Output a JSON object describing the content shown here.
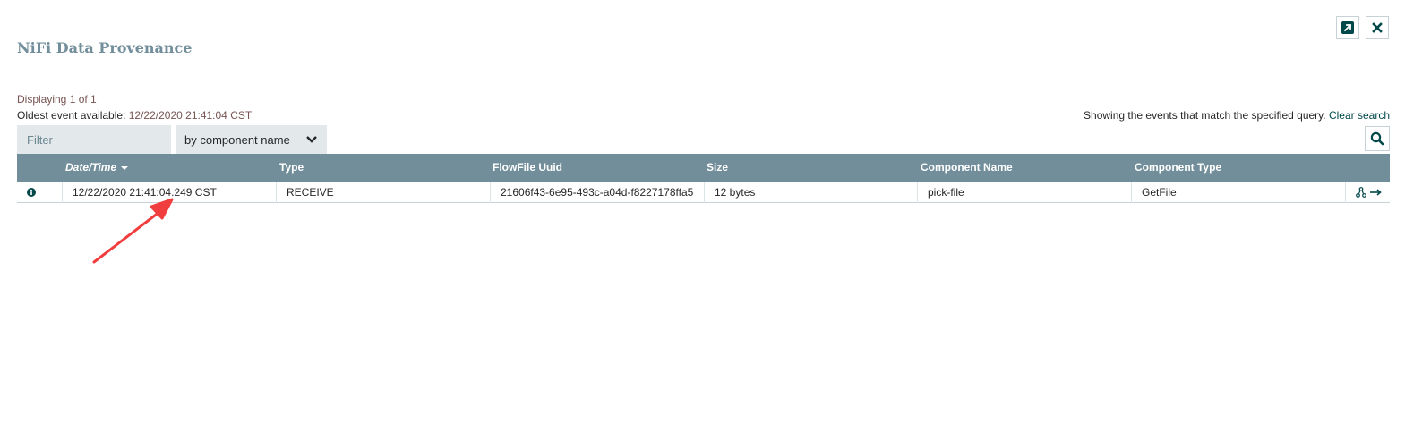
{
  "window": {
    "title": "NiFi Data Provenance",
    "icons": [
      "popout-icon",
      "close-icon"
    ]
  },
  "status": {
    "displaying": "Displaying 1 of 1",
    "oldest_label": "Oldest event available: ",
    "oldest_value": "12/22/2020 21:41:04 CST",
    "showing_text": "Showing the events that match the specified query.",
    "clear_search": "Clear search"
  },
  "filter": {
    "placeholder": "Filter",
    "value": "",
    "by_option": "by component name"
  },
  "table": {
    "columns": [
      "",
      "Date/Time",
      "Type",
      "FlowFile Uuid",
      "Size",
      "Component Name",
      "Component Type",
      ""
    ],
    "sorted_column": "Date/Time",
    "rows": [
      {
        "datetime": "12/22/2020 21:41:04.249 CST",
        "type": "RECEIVE",
        "uuid": "21606f43-6e95-493c-a04d-f8227178ffa5",
        "size": "12 bytes",
        "component_name": "pick-file",
        "component_type": "GetFile"
      }
    ]
  },
  "colors": {
    "header_bg": "#728e9b",
    "title": "#728e9b",
    "accent_dark": "#004849",
    "value_text": "#775351",
    "filter_bg": "#e3e8eb",
    "annotation_arrow": "#f03e3e"
  }
}
